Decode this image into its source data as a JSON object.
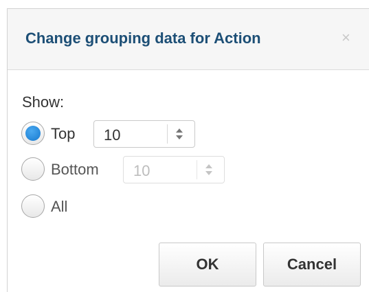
{
  "dialog": {
    "title": "Change grouping data for Action",
    "close_glyph": "×",
    "show_label": "Show:",
    "options": [
      {
        "label": "Top",
        "checked": true,
        "spinner_value": "10",
        "spinner_enabled": true
      },
      {
        "label": "Bottom",
        "checked": false,
        "spinner_value": "10",
        "spinner_enabled": false
      },
      {
        "label": "All",
        "checked": false
      }
    ],
    "buttons": {
      "ok": "OK",
      "cancel": "Cancel"
    }
  },
  "colors": {
    "title": "#1d4f76",
    "radio_checked": "#1679cf",
    "header_bg": "#f6f6f6"
  },
  "icons": {
    "close": "close-icon",
    "spinner_up": "chevron-up-icon",
    "spinner_down": "chevron-down-icon"
  }
}
